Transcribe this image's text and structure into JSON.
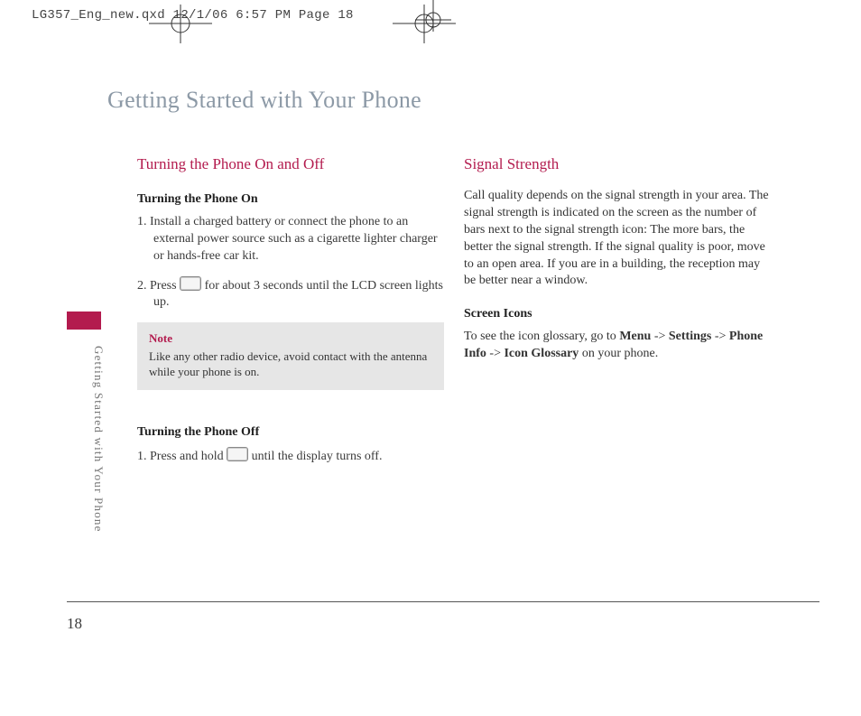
{
  "meta": {
    "header": "LG357_Eng_new.qxd  12/1/06  6:57 PM  Page 18",
    "page_number": "18",
    "side_label": "Getting Started with Your Phone",
    "chapter_title": "Getting Started with Your Phone"
  },
  "left": {
    "heading": "Turning the Phone On and Off",
    "sub1": "Turning the Phone On",
    "step1": "1. Install a charged battery or connect the phone to an external power source such as a cigarette lighter charger or hands-free car kit.",
    "step2a": "2. Press ",
    "step2b": " for about 3 seconds until the LCD screen lights up.",
    "note_title": "Note",
    "note_body": "Like any other radio device, avoid contact with the antenna while your phone is on.",
    "sub2": "Turning the Phone Off",
    "off1a": "1. Press and hold ",
    "off1b": " until the display turns off."
  },
  "right": {
    "heading": "Signal Strength",
    "para": "Call quality depends on the signal strength in your area. The signal strength is indicated on the screen as the number of bars next to the signal strength icon: The more bars, the better the signal strength. If the signal quality is poor, move to an open area. If you are in a building, the reception may be better near a window.",
    "sub": "Screen Icons",
    "icons_a": "To see the icon glossary, go to ",
    "nav_menu": "Menu",
    "nav_arrow": " -> ",
    "nav_settings": "Settings",
    "icons_b": " -> ",
    "nav_phoneinfo": "Phone Info",
    "icons_c": " -> ",
    "nav_glossary": "Icon Glossary",
    "icons_d": " on your phone."
  }
}
